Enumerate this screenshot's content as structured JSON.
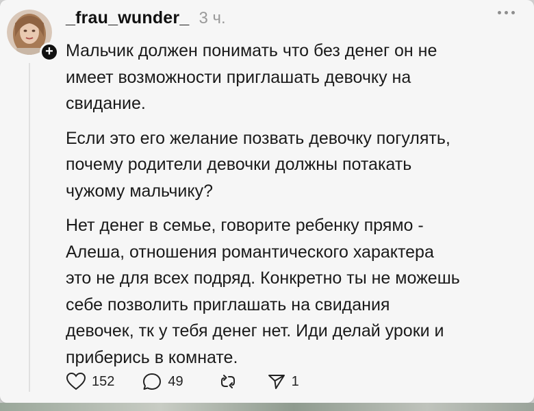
{
  "post": {
    "username": "_frau_wunder_",
    "timestamp": "3 ч.",
    "paragraphs": [
      "Мальчик должен понимать что без денег он не\nимеет возможности приглашать девочку на\nсвидание.",
      "Если это его желание позвать девочку погулять,\nпочему родители девочки должны потакать\nчужому мальчику?",
      "Нет денег в семье, говорите ребенку прямо -\nАлеша, отношения романтического характера\nэто не для всех подряд. Конкретно ты не можешь\nсебе позволить приглашать на свидания\nдевочек, тк у тебя денег нет. Иди делай уроки и\nприберись в комнате."
    ]
  },
  "actions": {
    "likes": "152",
    "replies": "49",
    "shares": "1"
  },
  "icons": {
    "like": "heart-icon",
    "reply": "speech-bubble-icon",
    "repost": "repost-icon",
    "share": "send-icon",
    "follow": "plus-icon",
    "more": "more-dots-icon"
  },
  "colors": {
    "background": "#f6f6f6",
    "text": "#1a1a1a",
    "muted": "#9a9a9a"
  }
}
